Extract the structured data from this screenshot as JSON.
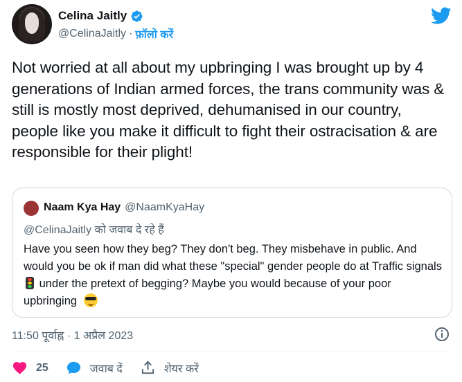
{
  "author": {
    "display_name": "Celina Jaitly",
    "handle": "@CelinaJaitly",
    "separator": "·",
    "follow_label": "फ़ॉलो करें"
  },
  "tweet": {
    "text": "Not worried at all about my upbringing I was brought up by 4 generations of Indian armed forces, the trans community was & still is mostly most deprived, dehumanised in our country, people like you make it difficult to fight their ostracisation & are responsible for their plight!"
  },
  "quoted_tweet": {
    "display_name": "Naam Kya Hay",
    "handle": "@NaamKyaHay",
    "reply_context": "@CelinaJaitly को जवाब दे रहे हैं",
    "text_part1": "Have you seen how they beg? They don't beg. They misbehave in public. And would you be ok if man did what these \"special\" gender people do at Traffic signals",
    "text_part2": "under the pretext of begging? Maybe you would because of your poor upbringing",
    "emoji_1": "traffic-light",
    "emoji_2": "sunglasses-face"
  },
  "meta": {
    "timestamp": "11:50 पूर्वाह्न · 1 अप्रैल 2023"
  },
  "actions": {
    "like_count": "25",
    "reply_label": "जवाब दें",
    "share_label": "शेयर करें"
  },
  "colors": {
    "brand_blue": "#1d9bf0",
    "like_red": "#f91880",
    "secondary_text": "#536471",
    "quoted_avatar": "#9b3434"
  },
  "icons": [
    "verified-badge-icon",
    "twitter-bird-icon",
    "info-icon",
    "heart-icon",
    "reply-bubble-icon",
    "share-upload-icon"
  ]
}
